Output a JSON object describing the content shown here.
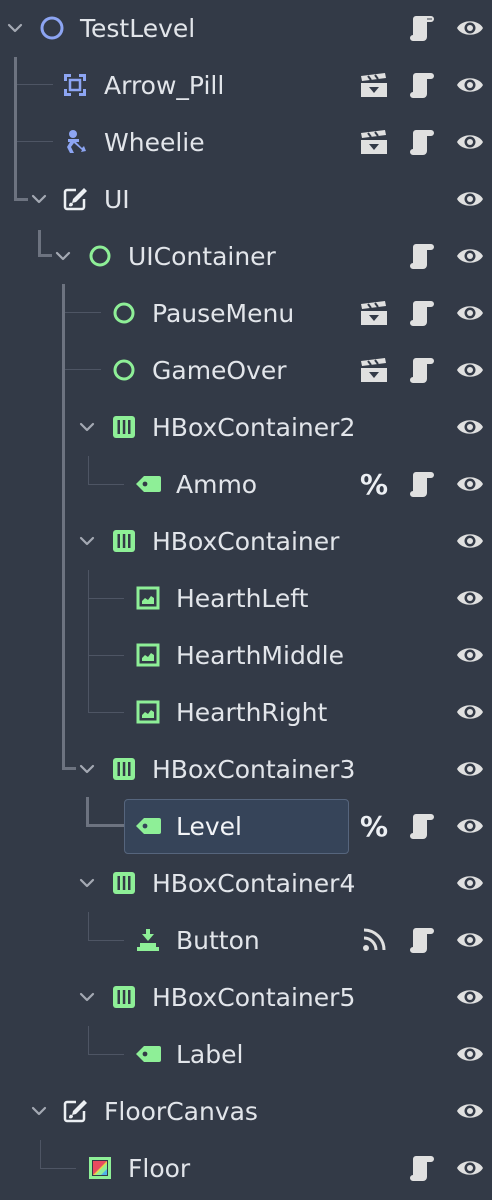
{
  "panel": "scene-tree",
  "nodes": [
    {
      "id": "testlevel",
      "label": "TestLevel",
      "icon": "node2d-circle-icon",
      "icon_color": "#8da5f3",
      "expanded": true,
      "actions": [
        "script",
        "visibility"
      ]
    },
    {
      "id": "arrow-pill",
      "label": "Arrow_Pill",
      "icon": "area2d-icon",
      "icon_color": "#8da5f3",
      "actions": [
        "instanced-scene",
        "script",
        "visibility"
      ]
    },
    {
      "id": "wheelie",
      "label": "Wheelie",
      "icon": "character-body-icon",
      "icon_color": "#8da5f3",
      "actions": [
        "instanced-scene",
        "script",
        "visibility"
      ]
    },
    {
      "id": "ui",
      "label": "UI",
      "icon": "canvas-layer-icon",
      "icon_color": "#eceff3",
      "expanded": true,
      "actions": [
        "visibility"
      ]
    },
    {
      "id": "uicontainer",
      "label": "UIContainer",
      "icon": "control-circle-icon",
      "icon_color": "#8eef97",
      "expanded": true,
      "actions": [
        "script",
        "visibility"
      ]
    },
    {
      "id": "pausemenu",
      "label": "PauseMenu",
      "icon": "control-circle-icon",
      "icon_color": "#8eef97",
      "actions": [
        "instanced-scene",
        "script",
        "visibility"
      ]
    },
    {
      "id": "gameover",
      "label": "GameOver",
      "icon": "control-circle-icon",
      "icon_color": "#8eef97",
      "actions": [
        "instanced-scene",
        "script",
        "visibility"
      ]
    },
    {
      "id": "hbox2",
      "label": "HBoxContainer2",
      "icon": "hbox-container-icon",
      "icon_color": "#8eef97",
      "expanded": true,
      "actions": [
        "visibility"
      ]
    },
    {
      "id": "ammo",
      "label": "Ammo",
      "icon": "label-tag-icon",
      "icon_color": "#8eef97",
      "actions": [
        "unique-name",
        "script",
        "visibility"
      ]
    },
    {
      "id": "hbox1",
      "label": "HBoxContainer",
      "icon": "hbox-container-icon",
      "icon_color": "#8eef97",
      "expanded": true,
      "actions": [
        "visibility"
      ]
    },
    {
      "id": "hearthleft",
      "label": "HearthLeft",
      "icon": "texture-rect-icon",
      "icon_color": "#8eef97",
      "actions": [
        "visibility"
      ]
    },
    {
      "id": "hearthmiddle",
      "label": "HearthMiddle",
      "icon": "texture-rect-icon",
      "icon_color": "#8eef97",
      "actions": [
        "visibility"
      ]
    },
    {
      "id": "hearthright",
      "label": "HearthRight",
      "icon": "texture-rect-icon",
      "icon_color": "#8eef97",
      "actions": [
        "visibility"
      ]
    },
    {
      "id": "hbox3",
      "label": "HBoxContainer3",
      "icon": "hbox-container-icon",
      "icon_color": "#8eef97",
      "expanded": true,
      "actions": [
        "visibility"
      ]
    },
    {
      "id": "level",
      "label": "Level",
      "icon": "label-tag-icon",
      "icon_color": "#8eef97",
      "selected": true,
      "actions": [
        "unique-name",
        "script",
        "visibility"
      ]
    },
    {
      "id": "hbox4",
      "label": "HBoxContainer4",
      "icon": "hbox-container-icon",
      "icon_color": "#8eef97",
      "expanded": true,
      "actions": [
        "visibility"
      ]
    },
    {
      "id": "button",
      "label": "Button",
      "icon": "button-icon",
      "icon_color": "#8eef97",
      "actions": [
        "signal-connections",
        "script",
        "visibility"
      ]
    },
    {
      "id": "hbox5",
      "label": "HBoxContainer5",
      "icon": "hbox-container-icon",
      "icon_color": "#8eef97",
      "expanded": true,
      "actions": [
        "visibility"
      ]
    },
    {
      "id": "label",
      "label": "Label",
      "icon": "label-tag-icon",
      "icon_color": "#8eef97",
      "actions": [
        "visibility"
      ]
    },
    {
      "id": "floorcanvas",
      "label": "FloorCanvas",
      "icon": "canvas-layer-icon",
      "icon_color": "#eceff3",
      "expanded": true,
      "actions": [
        "visibility"
      ]
    },
    {
      "id": "floor",
      "label": "Floor",
      "icon": "tilemap-icon",
      "icon_color": "#8eef97",
      "actions": [
        "script",
        "visibility"
      ]
    }
  ],
  "unique_name_symbol": "%",
  "colors": {
    "background": "#333a47",
    "selection": "#364459",
    "text": "#e2e5ea",
    "node2d": "#8da5f3",
    "control": "#8eef97",
    "guide_lines": "#6d7380"
  }
}
